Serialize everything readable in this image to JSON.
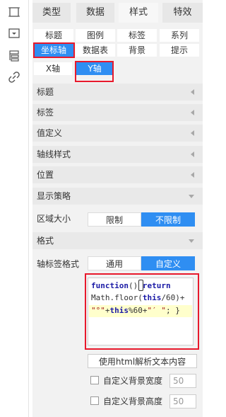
{
  "rail": {
    "icons": [
      "frame-icon",
      "dropdown-box-icon",
      "layers-icon",
      "link-icon"
    ]
  },
  "tabs": [
    "类型",
    "数据",
    "样式",
    "特效"
  ],
  "subtabs_row1": [
    "标题",
    "图例",
    "标签",
    "系列"
  ],
  "subtabs_row2": [
    "坐标轴",
    "数据表",
    "背景",
    "提示"
  ],
  "axis_tabs": [
    "X轴",
    "Y轴"
  ],
  "sections": {
    "title": "标题",
    "label": "标签",
    "value_def": "值定义",
    "axis_style": "轴线样式",
    "position": "位置",
    "display": "显示策略",
    "format": "格式"
  },
  "region_size": {
    "label": "区域大小",
    "options": [
      "限制",
      "不限制"
    ],
    "selected": "不限制"
  },
  "axis_label_format": {
    "label": "轴标签格式",
    "options": [
      "通用",
      "自定义"
    ],
    "selected": "自定义"
  },
  "editor": {
    "line1a": "function",
    "line1b": "()",
    "line1c": " return",
    "line2a": "Math.floor(",
    "line2b": "this",
    "line2c": "/60)+",
    "line3a": "\"°\"",
    "line3b": "+",
    "line3c": "this",
    "line3d": "%60+",
    "line3e": "\"′ \"",
    "line3f": "; }"
  },
  "html_parse_button": "使用html解析文本内容",
  "bg_width": {
    "label": "自定义背景宽度",
    "value": "50"
  },
  "bg_height": {
    "label": "自定义背景高度",
    "value": "50"
  },
  "colors": {
    "accent": "#2f8ef2",
    "highlight_border": "#e8192c"
  }
}
